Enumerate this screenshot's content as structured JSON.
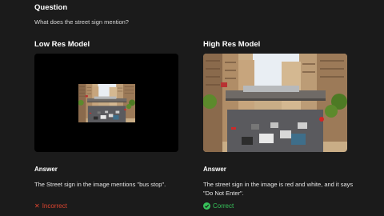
{
  "question": {
    "heading": "Question",
    "text": "What does the street sign mention?"
  },
  "low_res": {
    "title": "Low Res Model",
    "answer_heading": "Answer",
    "answer_text": "The Street sign in the image mentions \"bus stop\".",
    "verdict": "Incorrect",
    "verdict_color": "#e0452f"
  },
  "high_res": {
    "title": "High Res Model",
    "answer_heading": "Answer",
    "answer_text": "The street sign in the image is red and white, and it says \"Do Not Enter\".",
    "verdict": "Correct",
    "verdict_color": "#36c25a"
  }
}
